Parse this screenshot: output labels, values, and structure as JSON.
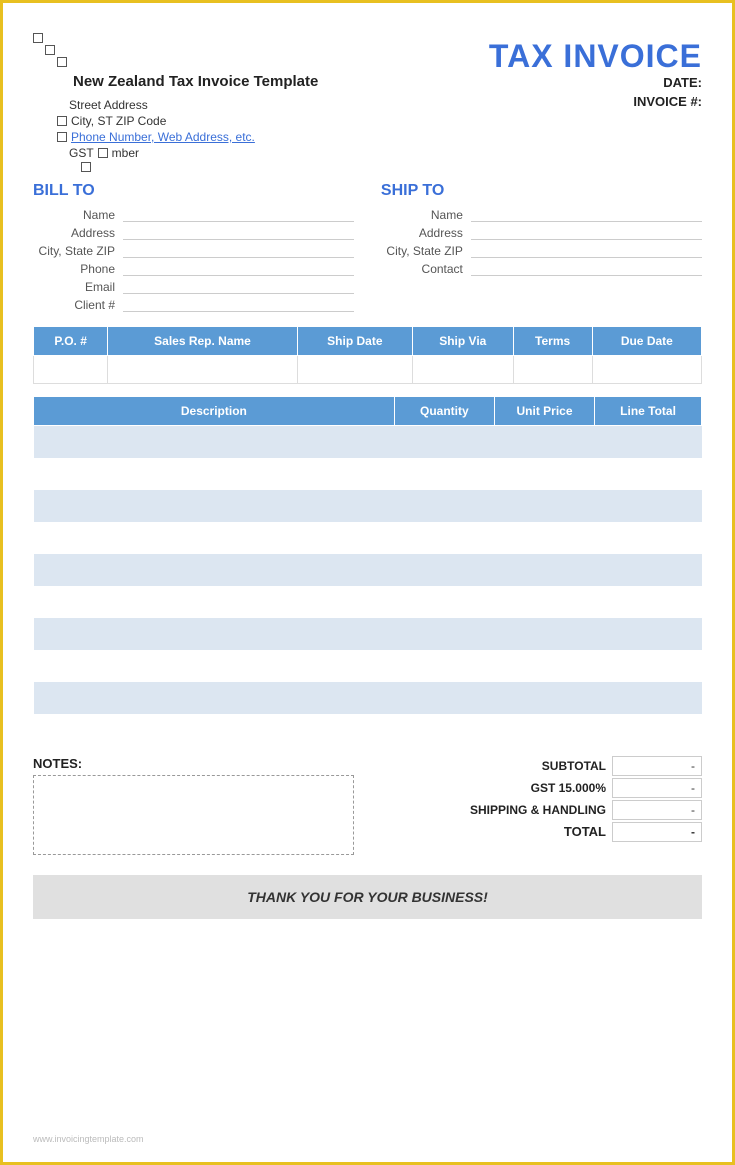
{
  "header": {
    "company_name": "New Zealand Tax Invoice Template",
    "title": "TAX INVOICE",
    "street": "Street Address",
    "city": "City, ST  ZIP Code",
    "phone_link": "Phone Number, Web Address, etc.",
    "gst_label": "GST Number",
    "date_label": "DATE:",
    "invoice_label": "INVOICE #:"
  },
  "bill_to": {
    "title": "BILL TO",
    "fields": [
      {
        "label": "Name",
        "value": ""
      },
      {
        "label": "Address",
        "value": ""
      },
      {
        "label": "City, State ZIP",
        "value": ""
      },
      {
        "label": "Phone",
        "value": ""
      },
      {
        "label": "Email",
        "value": ""
      },
      {
        "label": "Client #",
        "value": ""
      }
    ]
  },
  "ship_to": {
    "title": "SHIP TO",
    "fields": [
      {
        "label": "Name",
        "value": ""
      },
      {
        "label": "Address",
        "value": ""
      },
      {
        "label": "City, State ZIP",
        "value": ""
      },
      {
        "label": "Contact",
        "value": ""
      }
    ]
  },
  "order_table": {
    "headers": [
      "P.O. #",
      "Sales Rep. Name",
      "Ship Date",
      "Ship Via",
      "Terms",
      "Due Date"
    ],
    "row": [
      "",
      "",
      "",
      "",
      "",
      ""
    ]
  },
  "items_table": {
    "headers": [
      "Description",
      "Quantity",
      "Unit Price",
      "Line Total"
    ],
    "rows": [
      [
        "",
        "",
        "",
        ""
      ],
      [
        "",
        "",
        "",
        ""
      ],
      [
        "",
        "",
        "",
        ""
      ],
      [
        "",
        "",
        "",
        ""
      ],
      [
        "",
        "",
        "",
        ""
      ],
      [
        "",
        "",
        "",
        ""
      ],
      [
        "",
        "",
        "",
        ""
      ],
      [
        "",
        "",
        "",
        ""
      ],
      [
        "",
        "",
        "",
        ""
      ],
      [
        "",
        "",
        "",
        ""
      ]
    ]
  },
  "notes": {
    "label": "NOTES:"
  },
  "summary": {
    "subtotal_label": "SUBTOTAL",
    "subtotal_value": "-",
    "gst_label": "GST",
    "gst_rate": "15.000%",
    "gst_value": "-",
    "shipping_label": "SHIPPING & HANDLING",
    "shipping_value": "-",
    "total_label": "TOTAL",
    "total_value": "-"
  },
  "footer": {
    "thank_you": "THANK YOU FOR YOUR BUSINESS!",
    "watermark": "www.invoicingtemplate.com"
  }
}
